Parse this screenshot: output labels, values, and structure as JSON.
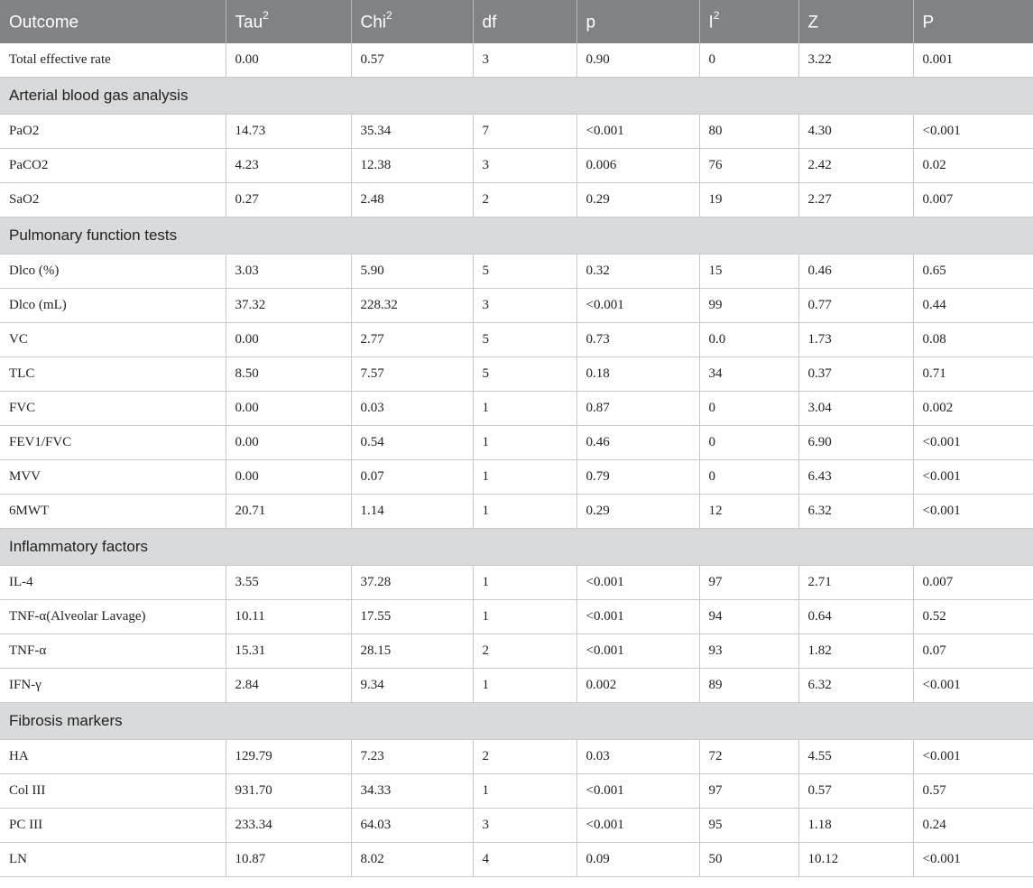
{
  "table": {
    "headers": [
      {
        "text": "Outcome",
        "sup": ""
      },
      {
        "text": "Tau",
        "sup": "2"
      },
      {
        "text": "Chi",
        "sup": "2"
      },
      {
        "text": "df",
        "sup": ""
      },
      {
        "text": "p",
        "sup": ""
      },
      {
        "text": "I",
        "sup": "2"
      },
      {
        "text": "Z",
        "sup": ""
      },
      {
        "text": "P",
        "sup": ""
      }
    ],
    "rows": [
      {
        "type": "data",
        "cells": [
          "Total effective rate",
          "0.00",
          "0.57",
          "3",
          "0.90",
          "0",
          "3.22",
          "0.001"
        ]
      },
      {
        "type": "section",
        "label": "Arterial blood gas analysis"
      },
      {
        "type": "data",
        "cells": [
          "PaO2",
          "14.73",
          "35.34",
          "7",
          "<0.001",
          "80",
          "4.30",
          "<0.001"
        ]
      },
      {
        "type": "data",
        "cells": [
          "PaCO2",
          "4.23",
          "12.38",
          "3",
          "0.006",
          "76",
          "2.42",
          "0.02"
        ]
      },
      {
        "type": "data",
        "cells": [
          "SaO2",
          "0.27",
          "2.48",
          "2",
          "0.29",
          "19",
          "2.27",
          "0.007"
        ]
      },
      {
        "type": "section",
        "label": "Pulmonary function tests"
      },
      {
        "type": "data",
        "cells": [
          "Dlco (%)",
          "3.03",
          "5.90",
          "5",
          "0.32",
          "15",
          "0.46",
          "0.65"
        ]
      },
      {
        "type": "data",
        "cells": [
          "Dlco (mL)",
          "37.32",
          "228.32",
          "3",
          "<0.001",
          "99",
          "0.77",
          "0.44"
        ]
      },
      {
        "type": "data",
        "cells": [
          "VC",
          "0.00",
          "2.77",
          "5",
          "0.73",
          "0.0",
          "1.73",
          "0.08"
        ]
      },
      {
        "type": "data",
        "cells": [
          "TLC",
          "8.50",
          "7.57",
          "5",
          "0.18",
          "34",
          "0.37",
          "0.71"
        ]
      },
      {
        "type": "data",
        "cells": [
          "FVC",
          "0.00",
          "0.03",
          "1",
          "0.87",
          "0",
          "3.04",
          "0.002"
        ]
      },
      {
        "type": "data",
        "cells": [
          "FEV1/FVC",
          "0.00",
          "0.54",
          "1",
          "0.46",
          "0",
          "6.90",
          "<0.001"
        ]
      },
      {
        "type": "data",
        "cells": [
          "MVV",
          "0.00",
          "0.07",
          "1",
          "0.79",
          "0",
          "6.43",
          "<0.001"
        ]
      },
      {
        "type": "data",
        "cells": [
          "6MWT",
          "20.71",
          "1.14",
          "1",
          "0.29",
          "12",
          "6.32",
          "<0.001"
        ]
      },
      {
        "type": "section",
        "label": "Inflammatory factors"
      },
      {
        "type": "data",
        "cells": [
          "IL-4",
          "3.55",
          "37.28",
          "1",
          "<0.001",
          "97",
          "2.71",
          "0.007"
        ]
      },
      {
        "type": "data",
        "cells": [
          "TNF-α(Alveolar Lavage)",
          "10.11",
          "17.55",
          "1",
          "<0.001",
          "94",
          "0.64",
          "0.52"
        ]
      },
      {
        "type": "data",
        "cells": [
          "TNF-α",
          "15.31",
          "28.15",
          "2",
          "<0.001",
          "93",
          "1.82",
          "0.07"
        ]
      },
      {
        "type": "data",
        "cells": [
          "IFN-γ",
          "2.84",
          "9.34",
          "1",
          "0.002",
          "89",
          "6.32",
          "<0.001"
        ]
      },
      {
        "type": "section",
        "label": "Fibrosis markers"
      },
      {
        "type": "data",
        "cells": [
          "HA",
          "129.79",
          "7.23",
          "2",
          "0.03",
          "72",
          "4.55",
          "<0.001"
        ]
      },
      {
        "type": "data",
        "cells": [
          "Col III",
          "931.70",
          "34.33",
          "1",
          "<0.001",
          "97",
          "0.57",
          "0.57"
        ]
      },
      {
        "type": "data",
        "cells": [
          "PC III",
          "233.34",
          "64.03",
          "3",
          "<0.001",
          "95",
          "1.18",
          "0.24"
        ]
      },
      {
        "type": "data",
        "cells": [
          "LN",
          "10.87",
          "8.02",
          "4",
          "0.09",
          "50",
          "10.12",
          "<0.001"
        ]
      }
    ]
  }
}
